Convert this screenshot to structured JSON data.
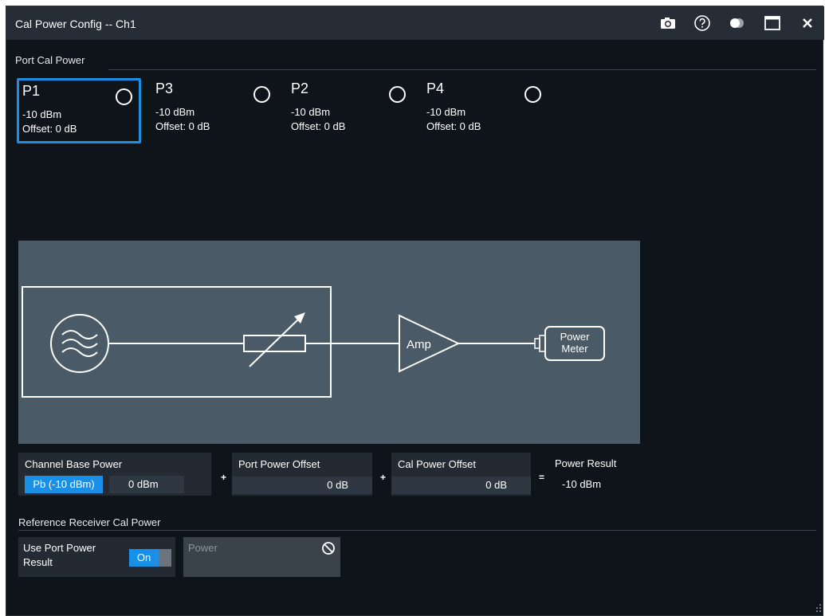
{
  "window": {
    "title": "Cal Power Config -- Ch1",
    "icons": [
      "camera-icon",
      "help-icon",
      "toggle-icon",
      "maximize-icon",
      "close-icon"
    ]
  },
  "port_cal_power": {
    "label": "Port Cal Power",
    "ports": [
      {
        "name": "P1",
        "power": "-10 dBm",
        "offset": "Offset: 0 dB",
        "selected": true
      },
      {
        "name": "P3",
        "power": "-10 dBm",
        "offset": "Offset: 0 dB",
        "selected": false
      },
      {
        "name": "P2",
        "power": "-10 dBm",
        "offset": "Offset: 0 dB",
        "selected": false
      },
      {
        "name": "P4",
        "power": "-10 dBm",
        "offset": "Offset: 0 dB",
        "selected": false
      }
    ]
  },
  "diagram": {
    "amp_label": "Amp",
    "meter_line1": "Power",
    "meter_line2": "Meter"
  },
  "calculation": {
    "channel_base_power": {
      "label": "Channel Base Power",
      "selector": "Pb (-10 dBm)",
      "value": "0 dBm"
    },
    "plus1": "+",
    "port_power_offset": {
      "label": "Port Power Offset",
      "value": "0 dB"
    },
    "plus2": "+",
    "cal_power_offset": {
      "label": "Cal Power Offset",
      "value": "0 dB"
    },
    "equals": "=",
    "power_result": {
      "label": "Power Result",
      "value": "-10 dBm"
    }
  },
  "reference_receiver": {
    "label": "Reference Receiver Cal Power",
    "use_port_power_line1": "Use Port Power",
    "use_port_power_line2": "Result",
    "toggle_state": "On",
    "power_placeholder": "Power"
  },
  "colors": {
    "accent": "#1a8fe8",
    "window_bg": "#0f141a",
    "titlebar_bg": "#262d36",
    "diagram_bg": "#4a5a66",
    "panel_bg": "#232a32"
  }
}
